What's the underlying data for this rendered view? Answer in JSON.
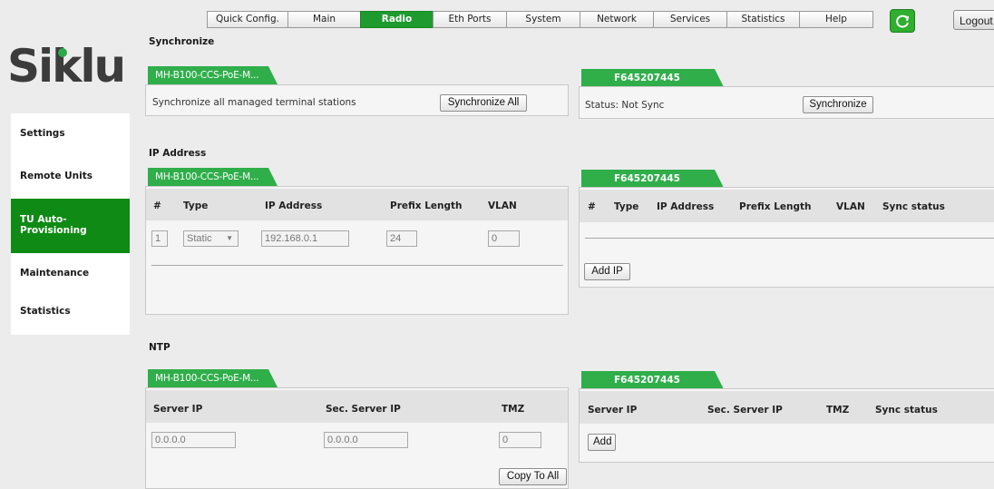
{
  "menu": [
    {
      "label": "Quick Config.",
      "w": 88
    },
    {
      "label": "Main",
      "w": 79
    },
    {
      "label": "Radio",
      "w": 79,
      "active": true
    },
    {
      "label": "Eth Ports",
      "w": 80
    },
    {
      "label": "System",
      "w": 80
    },
    {
      "label": "Network",
      "w": 80
    },
    {
      "label": "Services",
      "w": 80
    },
    {
      "label": "Statistics",
      "w": 79
    },
    {
      "label": "Help",
      "w": 80
    }
  ],
  "logout_label": "Logout",
  "logo_text": "Siklu",
  "sidebar": [
    {
      "label": "Settings"
    },
    {
      "label": "Remote Units"
    },
    {
      "label": "TU Auto-\nProvisioning",
      "active": true
    },
    {
      "label": "Maintenance"
    },
    {
      "label": "Statistics"
    }
  ],
  "sections": {
    "synchronize": "Synchronize",
    "ip_address": "IP Address",
    "ntp": "NTP"
  },
  "tabs": {
    "local": "MH-B100-CCS-PoE-M...",
    "remote": "F645207445"
  },
  "sync": {
    "local_text": "Synchronize all managed terminal stations",
    "local_button": "Synchronize All",
    "remote_status": "Status: Not Sync",
    "remote_button": "Synchronize"
  },
  "ip_local": {
    "headers": [
      "#",
      "Type",
      "IP Address",
      "Prefix Length",
      "VLAN"
    ],
    "row": {
      "num": "1",
      "type": "Static",
      "ip": "192.168.0.1",
      "prefix": "24",
      "vlan": "0"
    }
  },
  "ip_remote": {
    "headers": [
      "#",
      "Type",
      "IP Address",
      "Prefix Length",
      "VLAN",
      "Sync status"
    ],
    "add_button": "Add IP"
  },
  "ntp_local": {
    "headers": [
      "Server IP",
      "Sec. Server IP",
      "TMZ"
    ],
    "server_ip": "0.0.0.0",
    "sec_server_ip": "0.0.0.0",
    "tmz": "0",
    "copy_button": "Copy To All"
  },
  "ntp_remote": {
    "headers": [
      "Server IP",
      "Sec. Server IP",
      "TMZ",
      "Sync status"
    ],
    "add_button": "Add"
  },
  "colors": {
    "accent": "#1e9a2e",
    "tab": "#2fae4a",
    "sidebar_active": "#0f8a14"
  }
}
